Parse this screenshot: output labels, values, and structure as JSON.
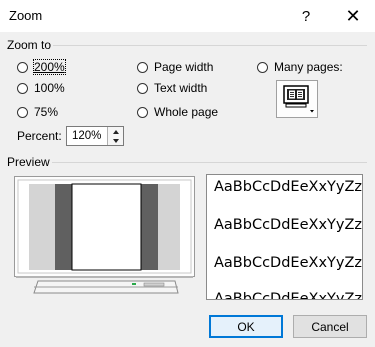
{
  "window": {
    "title": "Zoom",
    "help_glyph": "?",
    "close_glyph": "✕"
  },
  "zoom_to": {
    "label": "Zoom to",
    "options": [
      {
        "label": "200%",
        "selected": false
      },
      {
        "label": "100%",
        "selected": false
      },
      {
        "label": "75%",
        "selected": false
      },
      {
        "label": "Page width",
        "selected": false
      },
      {
        "label": "Text width",
        "selected": false
      },
      {
        "label": "Whole page",
        "selected": false
      },
      {
        "label": "Many pages:",
        "selected": false
      }
    ],
    "many_pages_icon": "monitor-pages-icon"
  },
  "percent": {
    "label": "Percent:",
    "value": "120%"
  },
  "preview": {
    "label": "Preview",
    "sample_lines": [
      "AaBbCcDdEeXxYyZz",
      "AaBbCcDdEeXxYyZz",
      "AaBbCcDdEeXxYyZz",
      "AaBbCcDdEeXxYyZz"
    ]
  },
  "buttons": {
    "ok": "OK",
    "cancel": "Cancel"
  },
  "colors": {
    "accent": "#0078d7",
    "background": "#f0f0f0"
  }
}
